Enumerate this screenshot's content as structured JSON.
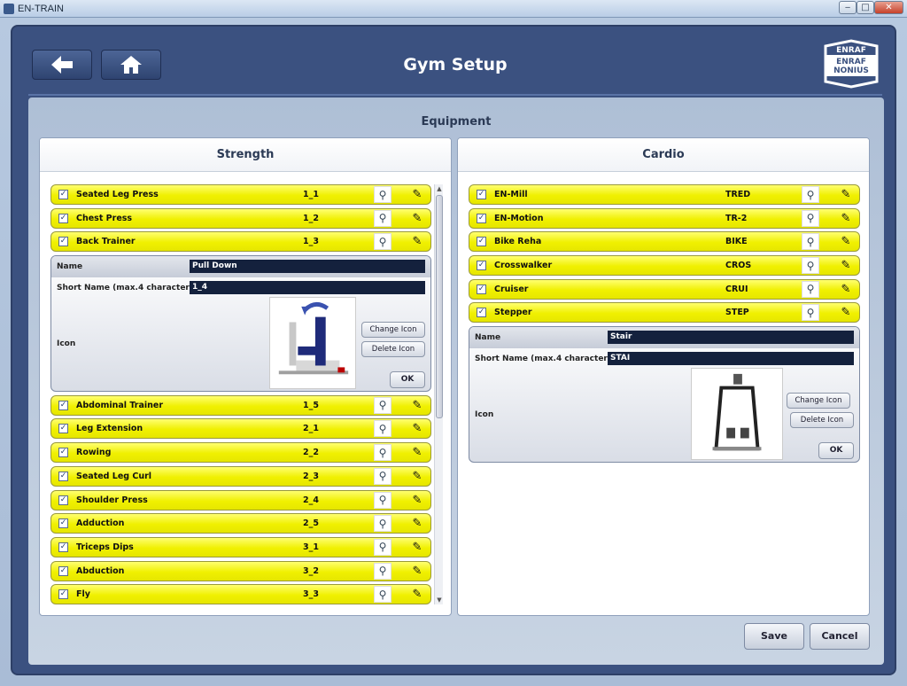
{
  "window": {
    "title": "EN-TRAIN",
    "min": "‒",
    "max": "□",
    "close": "✕"
  },
  "header": {
    "title": "Gym Setup",
    "back_icon": "arrow-left-icon",
    "home_icon": "home-icon",
    "logo_line1": "ENRAF",
    "logo_line2": "NONIUS"
  },
  "section_title": "Equipment",
  "strength": {
    "title": "Strength",
    "rows_before": [
      {
        "name": "Seated Leg Press",
        "short": "1_1"
      },
      {
        "name": "Chest Press",
        "short": "1_2"
      },
      {
        "name": "Back Trainer",
        "short": "1_3"
      }
    ],
    "editor": {
      "name_label": "Name",
      "name_value": "Pull Down",
      "short_label": "Short Name (max.4 characters)",
      "short_value": "1_4",
      "icon_label": "Icon",
      "change_icon": "Change Icon",
      "delete_icon": "Delete Icon",
      "ok": "OK"
    },
    "rows_after": [
      {
        "name": "Abdominal Trainer",
        "short": "1_5"
      },
      {
        "name": "Leg Extension",
        "short": "2_1"
      },
      {
        "name": "Rowing",
        "short": "2_2"
      },
      {
        "name": "Seated Leg Curl",
        "short": "2_3"
      },
      {
        "name": "Shoulder Press",
        "short": "2_4"
      },
      {
        "name": "Adduction",
        "short": "2_5"
      },
      {
        "name": "Triceps Dips",
        "short": "3_1"
      },
      {
        "name": "Abduction",
        "short": "3_2"
      },
      {
        "name": "Fly",
        "short": "3_3"
      }
    ]
  },
  "cardio": {
    "title": "Cardio",
    "rows": [
      {
        "name": "EN-Mill",
        "short": "TRED"
      },
      {
        "name": "EN-Motion",
        "short": "TR-2"
      },
      {
        "name": "Bike Reha",
        "short": "BIKE"
      },
      {
        "name": "Crosswalker",
        "short": "CROS"
      },
      {
        "name": "Cruiser",
        "short": "CRUI"
      },
      {
        "name": "Stepper",
        "short": "STEP"
      }
    ],
    "editor": {
      "name_label": "Name",
      "name_value": "Stair",
      "short_label": "Short Name (max.4 characters)",
      "short_value": "STAI",
      "icon_label": "Icon",
      "change_icon": "Change Icon",
      "delete_icon": "Delete Icon",
      "ok": "OK"
    }
  },
  "footer": {
    "save": "Save",
    "cancel": "Cancel"
  },
  "colors": {
    "row_yellow": "#f0f000",
    "app_blue": "#3b5180",
    "field_dark": "#14213d"
  }
}
